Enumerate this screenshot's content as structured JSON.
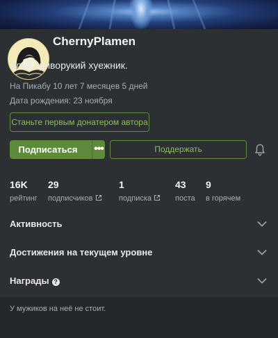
{
  "profile": {
    "username": "ChernyPlamen",
    "bio": "Злой криворукий хуежник.",
    "tenure": "На Пикабу 10 лет 7 месяцев 5 дней",
    "birthday": "Дата рождения: 23 ноября",
    "donate_label": "Станьте первым донатером автора"
  },
  "actions": {
    "subscribe_label": "Подписаться",
    "more_label": "•••",
    "support_label": "Поддержать"
  },
  "stats": [
    {
      "value": "16K",
      "label": "рейтинг"
    },
    {
      "value": "29",
      "label": "подписчиков"
    },
    {
      "value": "1",
      "label": "подписка"
    },
    {
      "value": "43",
      "label": "поста"
    },
    {
      "value": "9",
      "label": "в горячем"
    }
  ],
  "sections": [
    {
      "title": "Активность"
    },
    {
      "title": "Достижения на текущем уровне"
    },
    {
      "title": "Награды"
    }
  ],
  "footer_text": "У мужиков на неё не стоит.",
  "colors": {
    "accent": "#5e8a3b",
    "accent_text": "#8cbf5c",
    "background": "#2d3033",
    "footer_background": "#25282a"
  },
  "icons": [
    "external-link-icon",
    "bell-icon",
    "chevron-down-icon",
    "question-icon"
  ]
}
